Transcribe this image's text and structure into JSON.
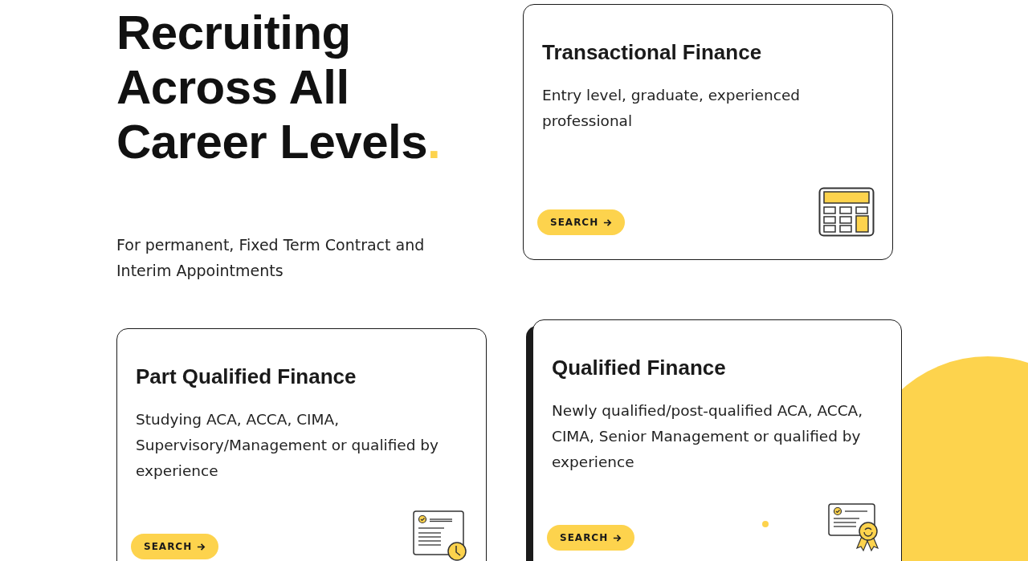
{
  "intro": {
    "heading": "Recruiting Across All Career Levels",
    "heading_accent": ".",
    "subtitle": "For permanent, Fixed Term Contract and Interim Appointments"
  },
  "cards": [
    {
      "title": "Transactional Finance",
      "description": "Entry level, graduate, experienced professional",
      "button": "SEARCH",
      "kind": "calculator",
      "raised": false
    },
    {
      "title": "Part Qualified Finance",
      "description": "Studying ACA, ACCA, CIMA, Supervisory/Management or qualified by experience",
      "button": "SEARCH",
      "kind": "certificate-clock",
      "raised": false
    },
    {
      "title": "Qualified Finance",
      "description": "Newly qualified/post-qualified ACA, ACCA, CIMA, Senior Management or qualified by experience",
      "button": "SEARCH",
      "kind": "certificate-ribbon",
      "raised": true
    }
  ]
}
